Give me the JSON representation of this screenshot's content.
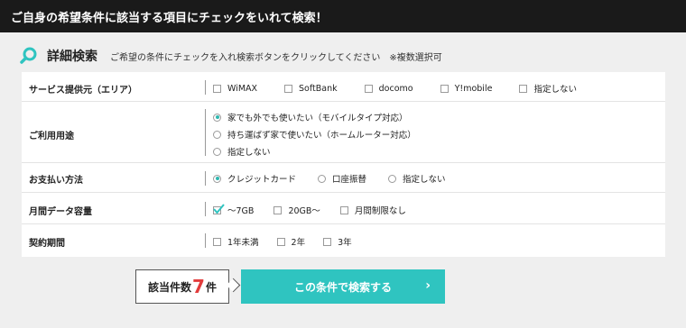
{
  "header": {
    "title": "ご自身の希望条件に該当する項目にチェックをいれて検索！"
  },
  "search": {
    "title": "詳細検索",
    "subtitle": "ご希望の条件にチェックを入れ検索ボタンをクリックしてください　※複数選択可"
  },
  "rows": [
    {
      "label": "サービス提供元（エリア）",
      "options": [
        "WiMAX",
        "SoftBank",
        "docomo",
        "Y!mobile",
        "指定しない"
      ]
    },
    {
      "label": "ご利用用途",
      "options": [
        "家でも外でも使いたい（モバイルタイプ対応）",
        "持ち運ばず家で使いたい（ホームルーター対応）",
        "指定しない"
      ]
    },
    {
      "label": "お支払い方法",
      "options": [
        "クレジットカード",
        "口座振替",
        "指定しない"
      ]
    },
    {
      "label": "月間データ容量",
      "options": [
        "～7GB",
        "20GB～",
        "月間制限なし"
      ]
    },
    {
      "label": "契約期間",
      "options": [
        "1年未満",
        "2年",
        "3年"
      ]
    }
  ],
  "result": {
    "prefix": "該当件数",
    "count": "7",
    "suffix": "件"
  },
  "button": {
    "label": "この条件で検索する",
    "chevron": "›"
  },
  "colors": {
    "accent": "#2fc4c0",
    "count": "#e23c3c",
    "header_bg": "#1a1a1a"
  },
  "icons": {
    "search": "search-icon",
    "check": "check-icon",
    "chevron": "chevron-right-icon"
  }
}
